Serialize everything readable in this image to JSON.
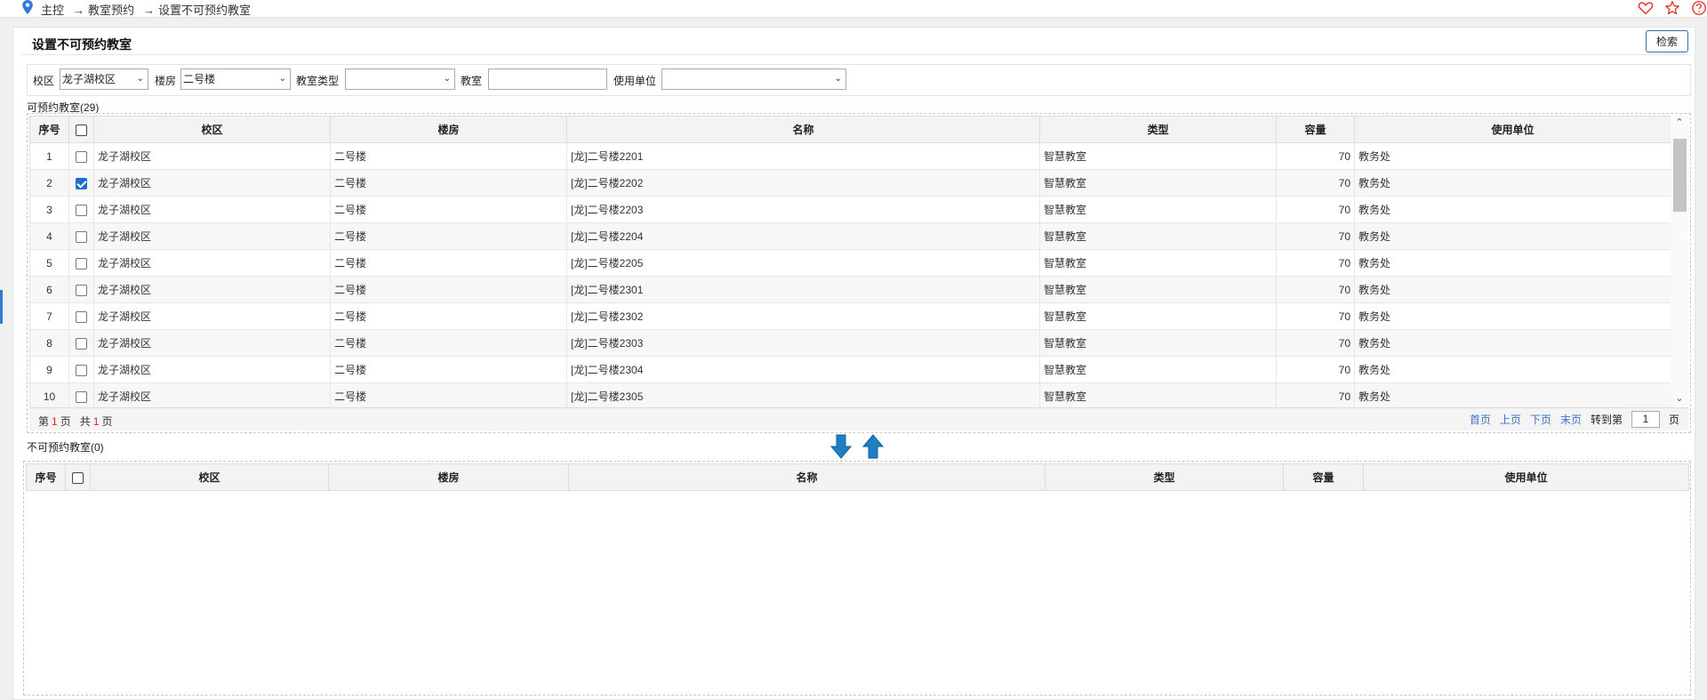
{
  "breadcrumb": {
    "items": [
      "主控",
      "教室预约",
      "设置不可预约教室"
    ],
    "separator": "→"
  },
  "top_icons": [
    "heart-icon",
    "star-icon",
    "help-icon"
  ],
  "page": {
    "title": "设置不可预约教室",
    "search_label": "检索"
  },
  "filters": {
    "campus_label": "校区",
    "campus_value": "龙子湖校区",
    "building_label": "楼房",
    "building_value": "二号楼",
    "room_type_label": "教室类型",
    "room_type_value": "",
    "room_label": "教室",
    "room_value": "",
    "unit_label": "使用单位",
    "unit_value": ""
  },
  "available": {
    "label": "可预约教室(29)",
    "columns": [
      "序号",
      "校区",
      "楼房",
      "名称",
      "类型",
      "容量",
      "使用单位"
    ],
    "rows": [
      {
        "num": "1",
        "checked": false,
        "campus": "龙子湖校区",
        "building": "二号楼",
        "name": "[龙]二号楼2201",
        "type": "智慧教室",
        "capacity": "70",
        "unit": "教务处"
      },
      {
        "num": "2",
        "checked": true,
        "campus": "龙子湖校区",
        "building": "二号楼",
        "name": "[龙]二号楼2202",
        "type": "智慧教室",
        "capacity": "70",
        "unit": "教务处"
      },
      {
        "num": "3",
        "checked": false,
        "campus": "龙子湖校区",
        "building": "二号楼",
        "name": "[龙]二号楼2203",
        "type": "智慧教室",
        "capacity": "70",
        "unit": "教务处"
      },
      {
        "num": "4",
        "checked": false,
        "campus": "龙子湖校区",
        "building": "二号楼",
        "name": "[龙]二号楼2204",
        "type": "智慧教室",
        "capacity": "70",
        "unit": "教务处"
      },
      {
        "num": "5",
        "checked": false,
        "campus": "龙子湖校区",
        "building": "二号楼",
        "name": "[龙]二号楼2205",
        "type": "智慧教室",
        "capacity": "70",
        "unit": "教务处"
      },
      {
        "num": "6",
        "checked": false,
        "campus": "龙子湖校区",
        "building": "二号楼",
        "name": "[龙]二号楼2301",
        "type": "智慧教室",
        "capacity": "70",
        "unit": "教务处"
      },
      {
        "num": "7",
        "checked": false,
        "campus": "龙子湖校区",
        "building": "二号楼",
        "name": "[龙]二号楼2302",
        "type": "智慧教室",
        "capacity": "70",
        "unit": "教务处"
      },
      {
        "num": "8",
        "checked": false,
        "campus": "龙子湖校区",
        "building": "二号楼",
        "name": "[龙]二号楼2303",
        "type": "智慧教室",
        "capacity": "70",
        "unit": "教务处"
      },
      {
        "num": "9",
        "checked": false,
        "campus": "龙子湖校区",
        "building": "二号楼",
        "name": "[龙]二号楼2304",
        "type": "智慧教室",
        "capacity": "70",
        "unit": "教务处"
      },
      {
        "num": "10",
        "checked": false,
        "campus": "龙子湖校区",
        "building": "二号楼",
        "name": "[龙]二号楼2305",
        "type": "智慧教室",
        "capacity": "70",
        "unit": "教务处"
      }
    ]
  },
  "pager": {
    "page_prefix": "第",
    "current_page": "1",
    "page_suffix": "页",
    "total_prefix": "共",
    "total_pages": "1",
    "total_suffix": "页",
    "first": "首页",
    "prev": "上页",
    "next": "下页",
    "last": "末页",
    "goto_label": "转到第",
    "goto_value": "1",
    "goto_suffix": "页"
  },
  "unavailable": {
    "label": "不可预约教室(0)",
    "columns": [
      "序号",
      "校区",
      "楼房",
      "名称",
      "类型",
      "容量",
      "使用单位"
    ]
  },
  "colors": {
    "accent": "#2f7ad5",
    "link": "#3a73c0",
    "checked": "#1a6fd1",
    "page_number": "#e02020",
    "arrow": "#1e7fc4"
  }
}
